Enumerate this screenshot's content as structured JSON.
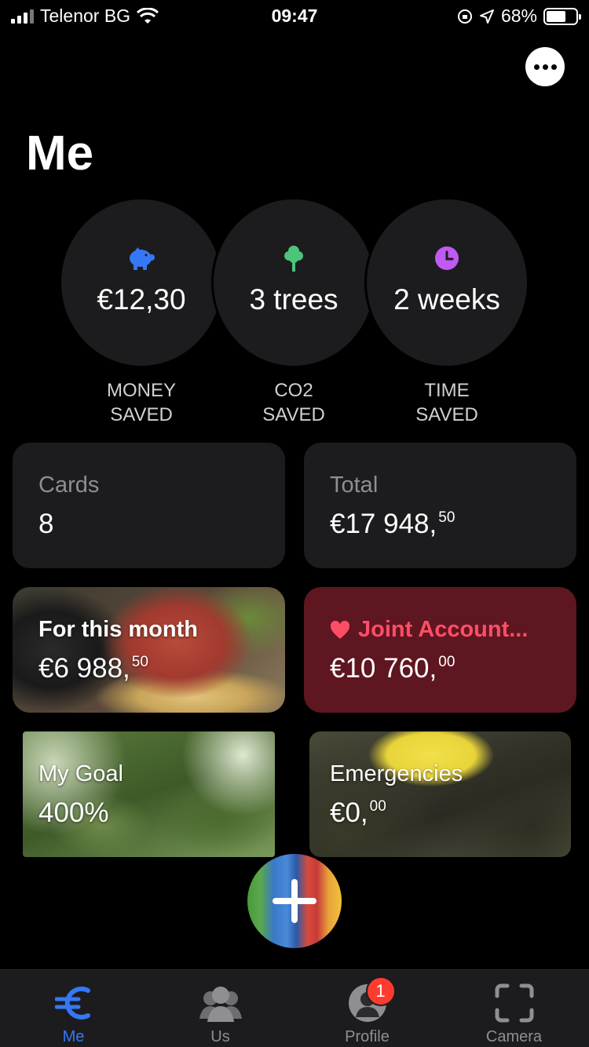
{
  "status_bar": {
    "carrier": "Telenor BG",
    "time": "09:47",
    "battery": "68%",
    "battery_level": 0.68
  },
  "header": {
    "title": "Me",
    "more_icon": "ellipsis-icon"
  },
  "stats": [
    {
      "value": "€12,30",
      "label_line1": "MONEY",
      "label_line2": "SAVED",
      "icon": "piggy-bank-icon",
      "color": "#3478f6"
    },
    {
      "value": "3 trees",
      "label_line1": "CO2",
      "label_line2": "SAVED",
      "icon": "tree-icon",
      "color": "#4cc47a"
    },
    {
      "value": "2 weeks",
      "label_line1": "TIME",
      "label_line2": "SAVED",
      "icon": "clock-icon",
      "color": "#bf5af2"
    }
  ],
  "cards": {
    "cards": {
      "title": "Cards",
      "value": "8"
    },
    "total": {
      "title": "Total",
      "value": "€17 948,",
      "cents": "50"
    },
    "month": {
      "title": "For this month",
      "value": "€6 988,",
      "cents": "50"
    },
    "joint": {
      "title": "Joint Account...",
      "value": "€10 760,",
      "cents": "00",
      "color": "#ff4d66"
    },
    "goal": {
      "title": "My Goal",
      "value": "400%"
    },
    "emergencies": {
      "title": "Emergencies",
      "value": "€0,",
      "cents": "00"
    }
  },
  "fab": {
    "icon": "plus-icon"
  },
  "tab_bar": {
    "tabs": [
      {
        "label": "Me",
        "icon": "euro-icon",
        "active": true
      },
      {
        "label": "Us",
        "icon": "group-icon",
        "active": false
      },
      {
        "label": "Profile",
        "icon": "profile-icon",
        "active": false,
        "badge": "1"
      },
      {
        "label": "Camera",
        "icon": "camera-frame-icon",
        "active": false
      }
    ],
    "active_color": "#3478f6"
  }
}
